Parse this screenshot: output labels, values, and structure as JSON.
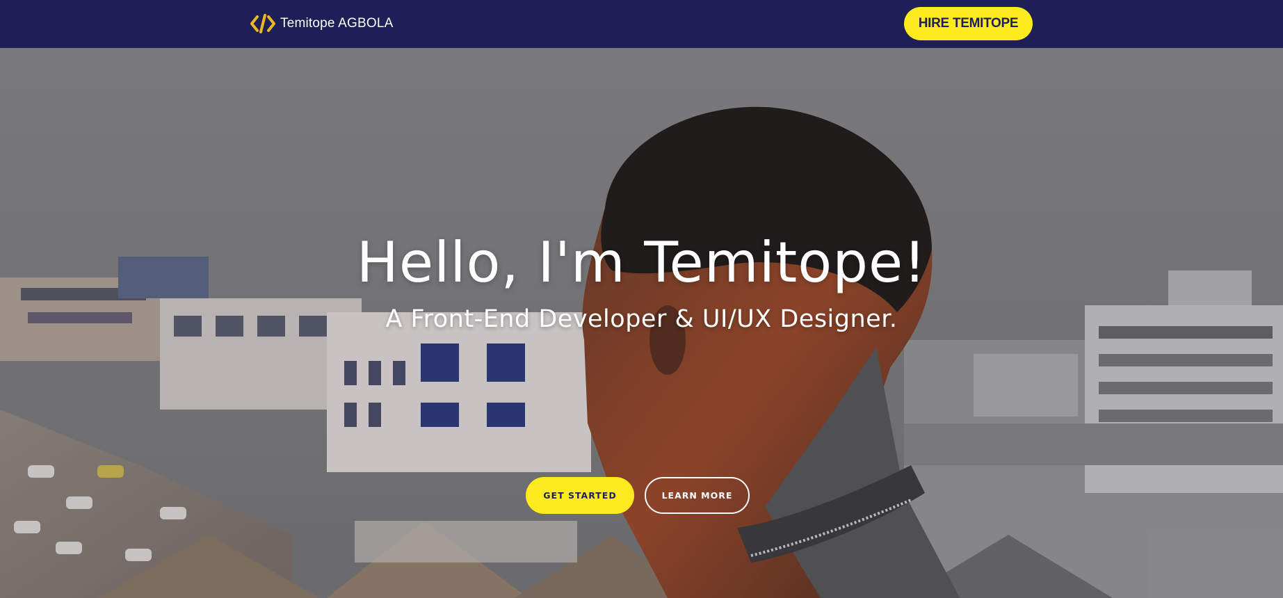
{
  "nav": {
    "brand_name": "Temitope AGBOLA",
    "brand_icon": "code-icon",
    "hire_label": "HIRE TEMITOPE"
  },
  "hero": {
    "headline": "Hello, I'm Temitope!",
    "subheadline": "A Front-End Developer & UI/UX Designer.",
    "primary_cta": "GET STARTED",
    "secondary_cta": "LEARN MORE"
  },
  "colors": {
    "navbar_bg": "#1e1f56",
    "accent_yellow": "#fdeb20",
    "text_light": "#ffffff"
  }
}
